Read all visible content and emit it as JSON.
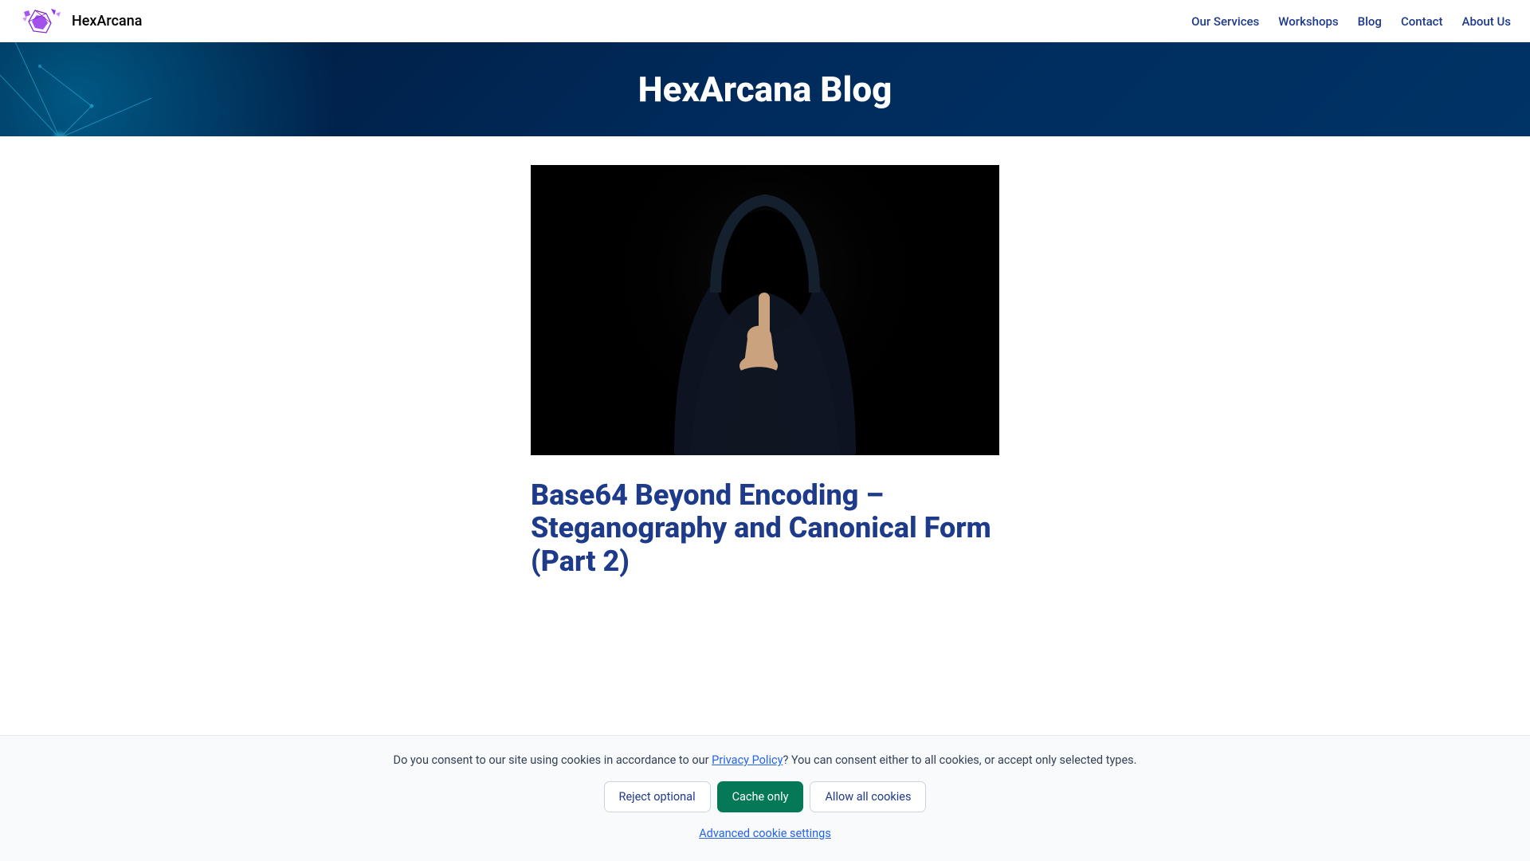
{
  "brand": {
    "name": "HexArcana"
  },
  "nav": {
    "items": [
      {
        "label": "Our Services"
      },
      {
        "label": "Workshops"
      },
      {
        "label": "Blog"
      },
      {
        "label": "Contact"
      },
      {
        "label": "About Us"
      }
    ]
  },
  "hero": {
    "title": "HexArcana Blog"
  },
  "post": {
    "title": "Base64 Beyond Encoding – Steganography and Canonical Form (Part 2)"
  },
  "cookie": {
    "text_prefix": "Do you consent to our site using cookies in accordance to our ",
    "privacy_link": "Privacy Policy",
    "text_suffix": "? You can consent either to all cookies, or accept only selected types.",
    "reject_label": "Reject optional",
    "cache_label": "Cache only",
    "allow_label": "Allow all cookies",
    "advanced_label": "Advanced cookie settings"
  }
}
